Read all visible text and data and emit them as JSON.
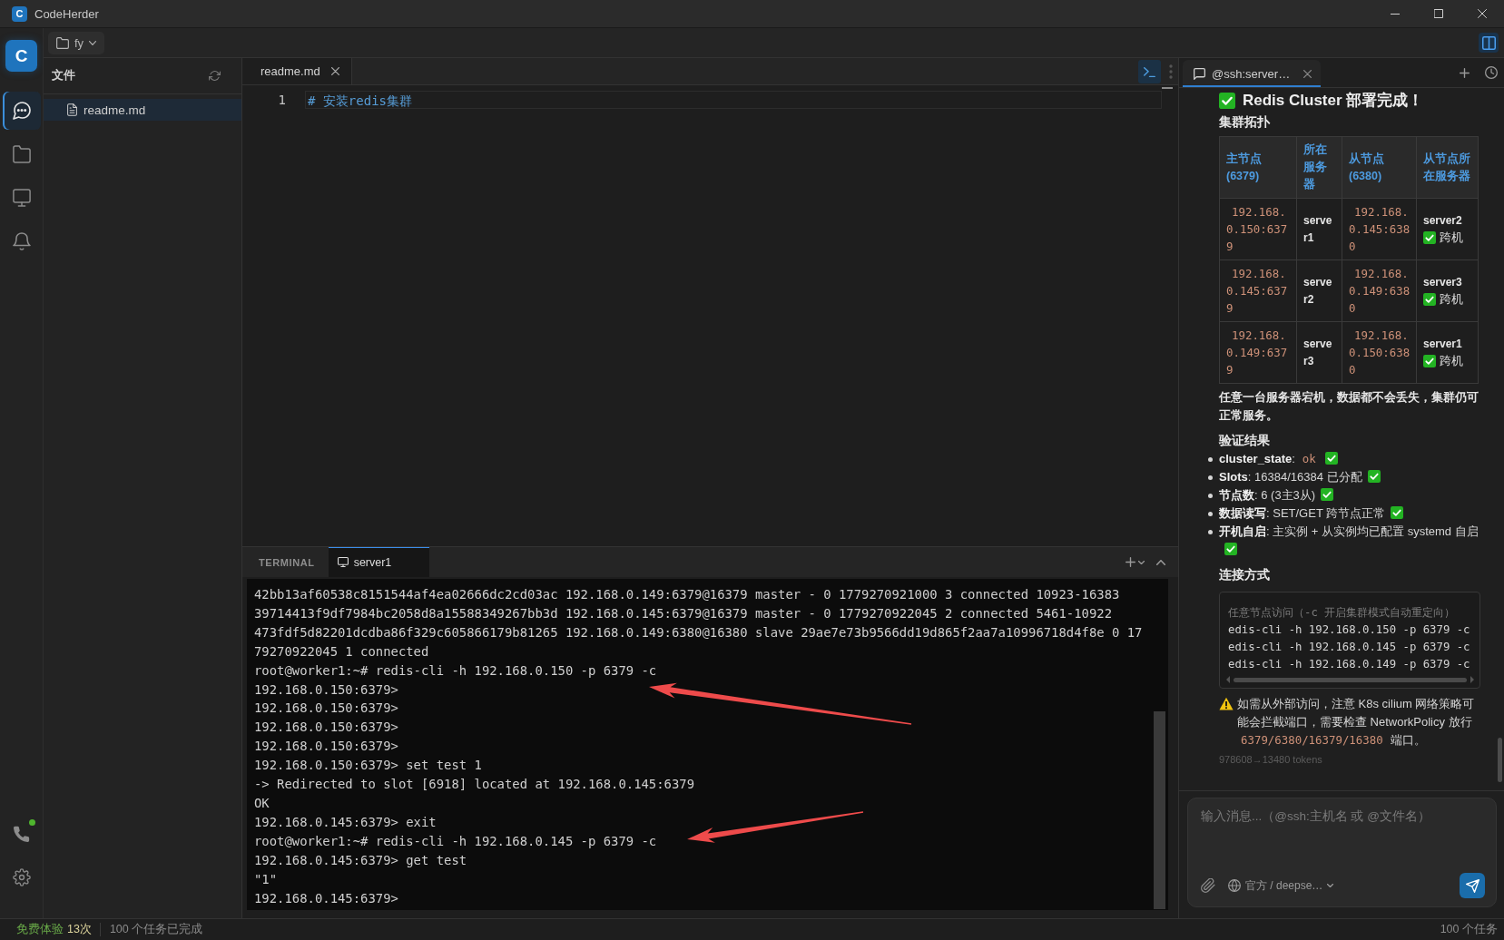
{
  "window": {
    "logo": "C",
    "title": "CodeHerder",
    "controls": [
      {
        "kind": "minimize"
      },
      {
        "kind": "maximize"
      },
      {
        "kind": "close"
      }
    ]
  },
  "activity_bar": {
    "logo": "C",
    "items": [
      {
        "kind": "chat",
        "selected": true
      },
      {
        "kind": "folder",
        "selected": false
      },
      {
        "kind": "monitor",
        "selected": false
      },
      {
        "kind": "bell",
        "selected": false
      }
    ],
    "bottom_items": [
      {
        "kind": "phone",
        "connected": true
      },
      {
        "kind": "settings"
      }
    ]
  },
  "toolbar": {
    "folder": "fy",
    "panel_toggle": {
      "on": true
    }
  },
  "file_panel": {
    "title": "文件",
    "files": [
      {
        "name": "readme.md",
        "selected": true
      }
    ]
  },
  "editor": {
    "tabs": [
      {
        "label": "readme.md",
        "selected": true
      }
    ],
    "terminal_toggle": {
      "on": true
    },
    "lines": [
      {
        "number": "1",
        "text": "# 安装redis集群",
        "current": true
      }
    ]
  },
  "terminal": {
    "title": "TERMINAL",
    "tabs": [
      {
        "label": "server1",
        "selected": true
      }
    ],
    "lines": [
      "42bb13af60538c8151544af4ea02666dc2cd03ac 192.168.0.149:6379@16379 master - 0 1779270921000 3 connected 10923-16383",
      "39714413f9df7984bc2058d8a15588349267bb3d 192.168.0.145:6379@16379 master - 0 1779270922045 2 connected 5461-10922",
      "473fdf5d82201dcdba86f329c605866179b81265 192.168.0.149:6380@16380 slave 29ae7e73b9566dd19d865f2aa7a10996718d4f8e 0 17",
      "79270922045 1 connected",
      "root@worker1:~# redis-cli -h 192.168.0.150 -p 6379 -c",
      "192.168.0.150:6379>",
      "192.168.0.150:6379>",
      "192.168.0.150:6379>",
      "192.168.0.150:6379>",
      "192.168.0.150:6379> set test 1",
      "-> Redirected to slot [6918] located at 192.168.0.145:6379",
      "OK",
      "192.168.0.145:6379> exit",
      "root@worker1:~# redis-cli -h 192.168.0.145 -p 6379 -c",
      "192.168.0.145:6379> get test",
      "\"1\"",
      "192.168.0.145:6379>"
    ],
    "annotations": [
      {
        "kind": "arrow"
      },
      {
        "kind": "arrow"
      }
    ]
  },
  "chat": {
    "tabs": [
      {
        "label": "@ssh:server…",
        "selected": true
      }
    ],
    "message": {
      "heading": "Redis Cluster 部署完成！",
      "heading_verified": true,
      "blocks": [
        {
          "kind": "heading",
          "text": "集群拓扑"
        },
        {
          "kind": "table",
          "columns": [
            "主节点 (6379)",
            "所在服务器",
            "从节点 (6380)",
            "从节点所在服务器"
          ],
          "rows": [
            {
              "master": "192.168.0.150:6379",
              "server": "server1",
              "replica": "192.168.0.145:6380",
              "replica_server": "server2",
              "note": "跨机",
              "verified": true
            },
            {
              "master": "192.168.0.145:6379",
              "server": "server2",
              "replica": "192.168.0.149:6380",
              "replica_server": "server3",
              "note": "跨机",
              "verified": true
            },
            {
              "master": "192.168.0.149:6379",
              "server": "server3",
              "replica": "192.168.0.150:6380",
              "replica_server": "server1",
              "note": "跨机",
              "verified": true
            }
          ]
        },
        {
          "kind": "bold_paragraph",
          "text": "任意一台服务器宕机，数据都不会丢失，集群仍可正常服务。"
        },
        {
          "kind": "heading",
          "text": "验证结果"
        },
        {
          "kind": "list",
          "items": [
            {
              "parts": [
                {
                  "kind": "text",
                  "text": "**cluster_state**:"
                },
                {
                  "kind": "code",
                  "text": "ok"
                }
              ],
              "verified": true
            },
            {
              "parts": [
                {
                  "kind": "text",
                  "text": "**Slots**: 16384/16384 已分配"
                }
              ],
              "verified": true
            },
            {
              "parts": [
                {
                  "kind": "text",
                  "text": "**节点数**: 6 (3主3从)"
                }
              ],
              "verified": true
            },
            {
              "parts": [
                {
                  "kind": "text",
                  "text": "**数据读写**: SET/GET 跨节点正常"
                }
              ],
              "verified": true
            },
            {
              "parts": [
                {
                  "kind": "text",
                  "text": "**开机自启**: 主实例 + 从实例均已配置 systemd 自启"
                }
              ],
              "verified": true
            }
          ]
        },
        {
          "kind": "heading",
          "text": "连接方式"
        },
        {
          "kind": "code",
          "lines": [
            {
              "kind": "comment",
              "text": "任意节点访问（-c 开启集群模式自动重定向）"
            },
            {
              "kind": "command",
              "text": "edis-cli -h 192.168.0.150 -p 6379 -c"
            },
            {
              "kind": "command",
              "text": "edis-cli -h 192.168.0.145 -p 6379 -c"
            },
            {
              "kind": "command",
              "text": "edis-cli -h 192.168.0.149 -p 6379 -c"
            }
          ]
        },
        {
          "kind": "warning",
          "parts": [
            {
              "kind": "text",
              "text": "如需从外部访问，注意 K8s cilium 网络策略可能会拦截端口，需要检查 NetworkPolicy 放行"
            },
            {
              "kind": "code",
              "text": "6379/6380/16379/16380"
            },
            {
              "kind": "text",
              "text": "端口。"
            }
          ]
        }
      ]
    },
    "tokens": "978608→13480 tokens",
    "input": {
      "placeholder": "输入消息...（@ssh:主机名 或 @文件名）"
    },
    "model": "官方 / deepse…"
  },
  "status_bar": {
    "trial_label": "免费体验",
    "trial_count": "13次",
    "tasks_done": "100 个任务已完成",
    "tasks": "100 个任务"
  }
}
